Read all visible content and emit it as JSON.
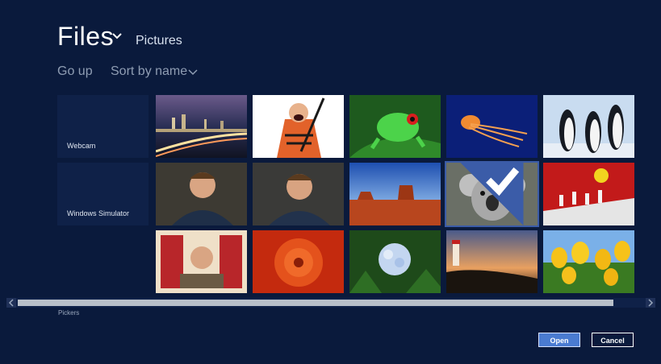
{
  "header": {
    "title": "Files",
    "location": "Pictures"
  },
  "toolbar": {
    "go_up": "Go up",
    "sort": "Sort by name"
  },
  "app_tiles": [
    {
      "label": "Webcam"
    },
    {
      "label": "Windows Simulator"
    }
  ],
  "photos": [
    {
      "name": "city-night"
    },
    {
      "name": "cartoon-samurai"
    },
    {
      "name": "tree-frog"
    },
    {
      "name": "jellyfish"
    },
    {
      "name": "penguins"
    },
    {
      "name": "man-portrait-1"
    },
    {
      "name": "man-portrait-2"
    },
    {
      "name": "desert-mesa"
    },
    {
      "name": "koala",
      "selected": true
    },
    {
      "name": "chess-chick"
    },
    {
      "name": "man-curtain"
    },
    {
      "name": "red-flower"
    },
    {
      "name": "hydrangea"
    },
    {
      "name": "lighthouse"
    },
    {
      "name": "tulips"
    }
  ],
  "footer": {
    "pickers_label": "Pickers",
    "open_label": "Open",
    "cancel_label": "Cancel"
  },
  "colors": {
    "background": "#0a1a3c",
    "accent": "#4a7bd1"
  }
}
